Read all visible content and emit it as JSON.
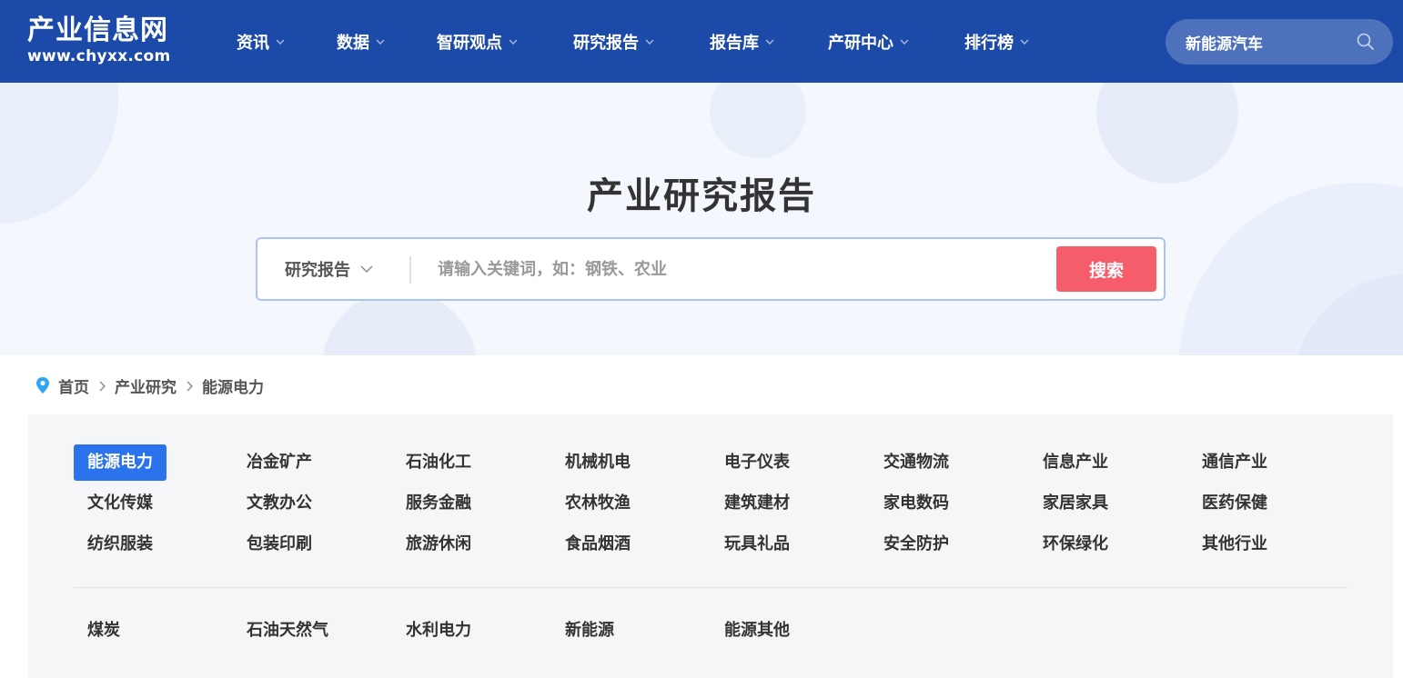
{
  "header": {
    "logo_text": "产业信息网",
    "logo_domain": "www.chyxx.com",
    "nav": [
      {
        "label": "资讯"
      },
      {
        "label": "数据"
      },
      {
        "label": "智研观点"
      },
      {
        "label": "研究报告"
      },
      {
        "label": "报告库"
      },
      {
        "label": "产研中心"
      },
      {
        "label": "排行榜"
      }
    ],
    "search_value": "新能源汽车"
  },
  "hero": {
    "title": "产业研究报告",
    "scope_label": "研究报告",
    "placeholder": "请输入关键词，如：钢铁、农业",
    "search_button": "搜索"
  },
  "breadcrumb": {
    "items": [
      "首页",
      "产业研究",
      "能源电力"
    ]
  },
  "categories": {
    "main": [
      [
        "能源电力",
        "冶金矿产",
        "石油化工",
        "机械机电",
        "电子仪表",
        "交通物流",
        "信息产业",
        "通信产业"
      ],
      [
        "文化传媒",
        "文教办公",
        "服务金融",
        "农林牧渔",
        "建筑建材",
        "家电数码",
        "家居家具",
        "医药保健"
      ],
      [
        "纺织服装",
        "包装印刷",
        "旅游休闲",
        "食品烟酒",
        "玩具礼品",
        "安全防护",
        "环保绿化",
        "其他行业"
      ]
    ],
    "active": "能源电力",
    "sub": [
      "煤炭",
      "石油天然气",
      "水利电力",
      "新能源",
      "能源其他"
    ]
  },
  "colors": {
    "header_bg": "#1c4aa8",
    "accent": "#2b73ec",
    "search_button": "#f55d6b"
  },
  "icons": {
    "dropdown": "chevron-down-icon",
    "search": "search-icon",
    "location": "location-pin-icon",
    "breadcrumb_sep": "chevron-right-icon"
  }
}
